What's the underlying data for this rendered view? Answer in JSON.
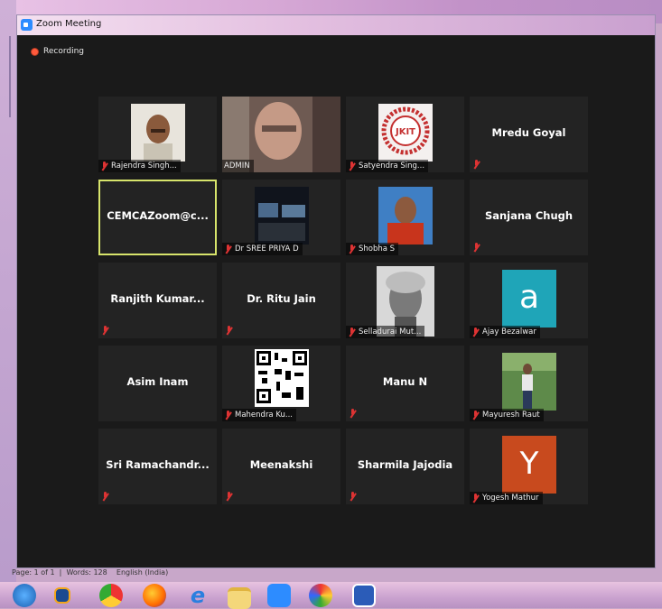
{
  "window": {
    "title": "Zoom Meeting"
  },
  "recording": {
    "label": "Recording"
  },
  "tiles": [
    {
      "name": "Rajendra Singh...",
      "type": "video"
    },
    {
      "name": "ADMIN",
      "type": "video"
    },
    {
      "name": "Satyendra Sing...",
      "type": "video"
    },
    {
      "name": "Mredu Goyal",
      "type": "text"
    },
    {
      "name": "CEMCAZoom@c...",
      "type": "text",
      "active": true
    },
    {
      "name": "Dr SREE PRIYA D",
      "type": "video"
    },
    {
      "name": "Shobha S",
      "type": "video"
    },
    {
      "name": "Sanjana Chugh",
      "type": "text"
    },
    {
      "name": "Ranjith  Kumar...",
      "type": "text"
    },
    {
      "name": "Dr. Ritu Jain",
      "type": "text"
    },
    {
      "name": "Selladurai Mut...",
      "type": "video"
    },
    {
      "name": "Ajay Bezalwar",
      "type": "avatar",
      "letter": "a",
      "color": "#1fa5b8"
    },
    {
      "name": "Asim Inam",
      "type": "text"
    },
    {
      "name": "Mahendra Ku...",
      "type": "video"
    },
    {
      "name": "Manu N",
      "type": "text"
    },
    {
      "name": "Mayuresh Raut",
      "type": "video"
    },
    {
      "name": "Sri  Ramachandr...",
      "type": "text"
    },
    {
      "name": "Meenakshi",
      "type": "text"
    },
    {
      "name": "Sharmila Jajodia",
      "type": "text"
    },
    {
      "name": "Yogesh Mathur",
      "type": "avatar",
      "letter": "Y",
      "color": "#c84a1e"
    }
  ],
  "logo_text": "JKIT",
  "word_status": {
    "page": "Page: 1 of 1",
    "words": "Words: 128",
    "language": "English (India)"
  },
  "taskbar": {
    "items": [
      "start-icon",
      "media-player-icon",
      "chrome-icon",
      "firefox-icon",
      "ie-icon",
      "folder-icon",
      "zoom-icon",
      "paint-icon",
      "word-icon"
    ]
  }
}
